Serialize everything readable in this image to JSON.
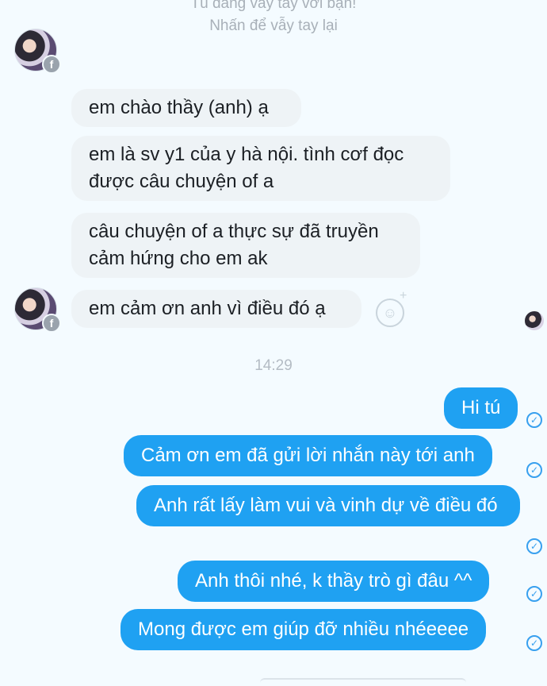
{
  "system": {
    "wave_status": "Tú đang vẫy tay với bạn!",
    "wave_back": "Nhấn để vẫy tay lại"
  },
  "messages_in": [
    {
      "text": "em chào thầy (anh) ạ"
    },
    {
      "text": "em là sv y1 của y hà nội. tình cơf đọc được câu chuyện of a"
    },
    {
      "text": "câu chuyện of a thực sự đã truyền cảm hứng cho em ak"
    },
    {
      "text": "em cảm ơn anh vì điều đó ạ"
    }
  ],
  "timestamp": "14:29",
  "messages_out": [
    {
      "text": "Hi tú"
    },
    {
      "text": "Cảm ơn em đã gửi lời nhắn này tới anh"
    },
    {
      "text": "Anh rất lấy làm vui và vinh dự về điều đó"
    },
    {
      "text": "Anh thôi nhé, k thầy trò gì đâu ^^"
    },
    {
      "text": "Mong được em giúp đỡ nhiều nhéeeee"
    }
  ],
  "icons": {
    "avatar_badge": "facebook-icon",
    "emoji": "smiley-icon",
    "delivered": "check-circle-icon"
  },
  "colors": {
    "outgoing_bubble": "#1fa1f2",
    "incoming_bubble": "#eef3f6",
    "background": "#f4fbff"
  }
}
